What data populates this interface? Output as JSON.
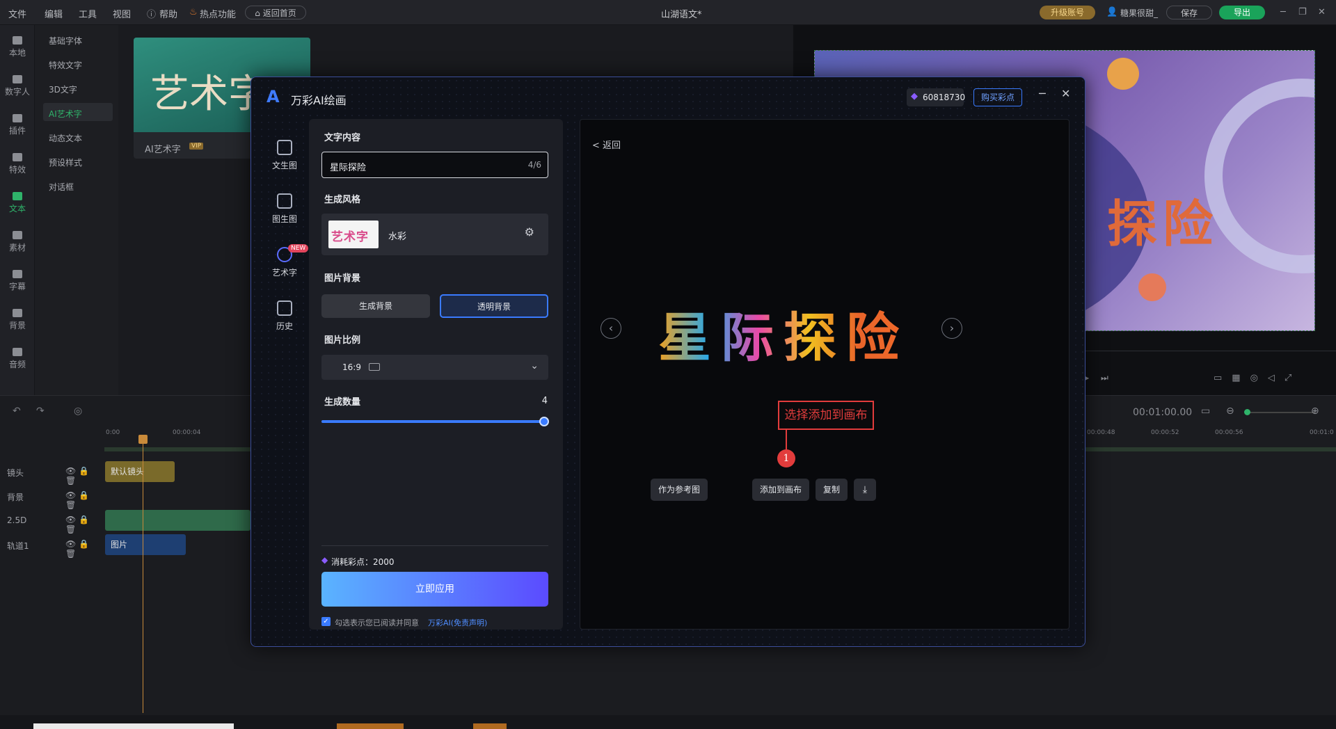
{
  "app": {
    "menus": [
      "文件",
      "编辑",
      "工具",
      "视图",
      "帮助",
      "热点功能"
    ],
    "home_button": "返回首页",
    "title": "山湖语文*",
    "upgrade": "升级账号",
    "user": "糖果很甜_",
    "save": "保存",
    "export": "导出"
  },
  "rail": [
    "本地",
    "数字人",
    "插件",
    "特效",
    "文本",
    "素材",
    "字幕",
    "背景",
    "音频"
  ],
  "categories": [
    "基础字体",
    "特效文字",
    "3D文字",
    "AI艺术字",
    "动态文本",
    "预设样式",
    "对话框"
  ],
  "library": {
    "card_label": "AI艺术字",
    "card_badge": "VIP",
    "card_text": "艺术字"
  },
  "preview": {
    "art_text": "探险",
    "time": "00:01:00.00"
  },
  "timeline": {
    "ruler": [
      "0:00",
      "00:00:04",
      "00:00:48",
      "00:00:52",
      "00:00:56",
      "00:01:0"
    ],
    "tracks": [
      "镜头",
      "背景",
      "2.5D",
      "轨道1"
    ],
    "clip_camera": "默认镜头",
    "clip_image": "图片"
  },
  "dialog": {
    "title": "万彩AI绘画",
    "points": "60818730",
    "buy": "购买彩点",
    "nav": [
      "文生图",
      "图生图",
      "艺术字",
      "历史"
    ],
    "new_badge": "NEW",
    "text_label": "文字内容",
    "text_value": "星际探险",
    "text_count": "4/6",
    "style_label": "生成风格",
    "style_name": "水彩",
    "style_thumb": "艺术字",
    "bg_label": "图片背景",
    "bg_options": [
      "生成背景",
      "透明背景"
    ],
    "ratio_label": "图片比例",
    "ratio_value": "16:9",
    "count_label": "生成数量",
    "count_value": "4",
    "count_fraction": 1.0,
    "cost": "消耗彩点：2000",
    "apply": "立即应用",
    "agree_prefix": "勾选表示您已阅读并同意",
    "agree_link": "万彩AI(免责声明)",
    "back": "< 返回",
    "result_text": "星际探险",
    "callout": "选择添加到画布",
    "callout_num": "1",
    "actions": [
      "作为参考图",
      "添加到画布",
      "复制"
    ]
  },
  "colors": {
    "accent": "#3a7bff",
    "apply_start": "#5ab4ff",
    "apply_end": "#5b4bff",
    "callout": "#e23c3c",
    "export_green": "#1aa35a",
    "upgrade_gold": "#c4953a"
  }
}
